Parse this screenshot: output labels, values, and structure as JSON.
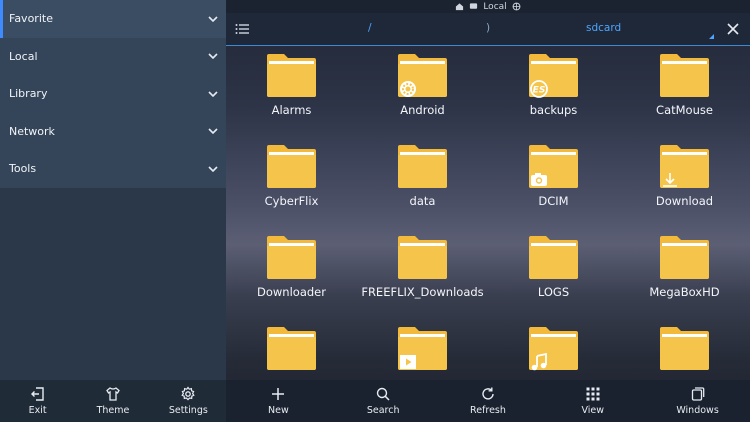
{
  "statusbar": {
    "label": "Local"
  },
  "sidebar": {
    "items": [
      {
        "label": "Favorite"
      },
      {
        "label": "Local"
      },
      {
        "label": "Library"
      },
      {
        "label": "Network"
      },
      {
        "label": "Tools"
      }
    ],
    "bottom": [
      {
        "label": "Exit",
        "icon": "exit-icon"
      },
      {
        "label": "Theme",
        "icon": "shirt-icon"
      },
      {
        "label": "Settings",
        "icon": "gear-icon"
      }
    ]
  },
  "pathbar": {
    "root": "/",
    "separator": ")",
    "current": "sdcard"
  },
  "folders": [
    {
      "name": "Alarms",
      "badge": ""
    },
    {
      "name": "Android",
      "badge": "gear-icon"
    },
    {
      "name": "backups",
      "badge": "es-logo-icon"
    },
    {
      "name": "CatMouse",
      "badge": ""
    },
    {
      "name": "CyberFlix",
      "badge": ""
    },
    {
      "name": "data",
      "badge": ""
    },
    {
      "name": "DCIM",
      "badge": "camera-icon"
    },
    {
      "name": "Download",
      "badge": "download-icon"
    },
    {
      "name": "Downloader",
      "badge": ""
    },
    {
      "name": "FREEFLIX_Downloads",
      "badge": ""
    },
    {
      "name": "LOGS",
      "badge": ""
    },
    {
      "name": "MegaBoxHD",
      "badge": ""
    },
    {
      "name": "",
      "badge": ""
    },
    {
      "name": "",
      "badge": "video-icon"
    },
    {
      "name": "",
      "badge": "music-icon"
    },
    {
      "name": "",
      "badge": ""
    }
  ],
  "toolbar": [
    {
      "label": "New",
      "icon": "plus-icon"
    },
    {
      "label": "Search",
      "icon": "search-icon"
    },
    {
      "label": "Refresh",
      "icon": "refresh-icon"
    },
    {
      "label": "View",
      "icon": "grid-view-icon"
    },
    {
      "label": "Windows",
      "icon": "windows-icon"
    }
  ],
  "colors": {
    "accent": "#4ea5ff",
    "folder": "#f5c242",
    "sidebar": "#34455a"
  }
}
